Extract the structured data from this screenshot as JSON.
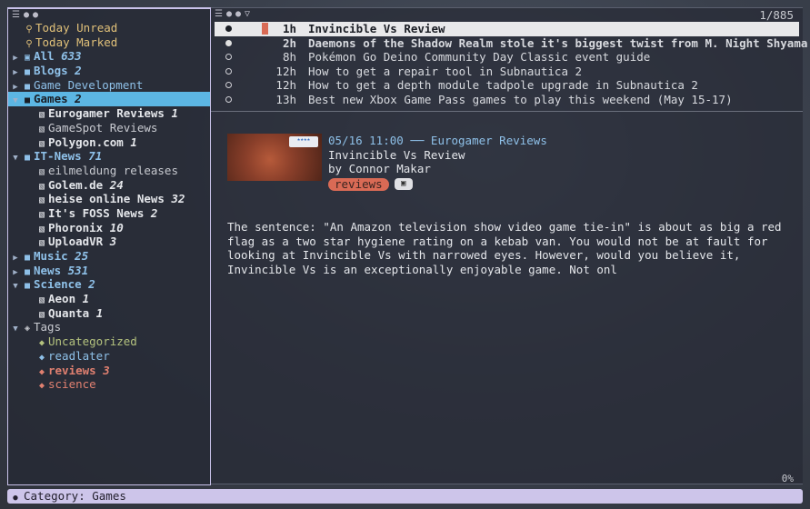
{
  "left_pane": {
    "tree": [
      {
        "level": 1,
        "arrow": "",
        "icon": "⚲",
        "label": "Today Unread",
        "count": "",
        "color": "c-yellow",
        "bold": false,
        "icon_name": "search-icon",
        "name": "today-unread"
      },
      {
        "level": 1,
        "arrow": "",
        "icon": "⚲",
        "label": "Today Marked",
        "count": "",
        "color": "c-yellow",
        "bold": false,
        "icon_name": "search-icon",
        "name": "today-marked"
      },
      {
        "level": 0,
        "arrow": "▶",
        "icon": "▣",
        "label": "All",
        "count": "633",
        "color": "c-blue",
        "bold": true,
        "icon_name": "all-feeds-icon",
        "name": "all"
      },
      {
        "level": 0,
        "arrow": "▶",
        "icon": "■",
        "label": "Blogs",
        "count": "2",
        "color": "c-blue",
        "bold": true,
        "icon_name": "folder-icon",
        "name": "blogs"
      },
      {
        "level": 0,
        "arrow": "▶",
        "icon": "■",
        "label": "Game Development",
        "count": "",
        "color": "c-blue",
        "bold": false,
        "icon_name": "folder-icon",
        "name": "game-development"
      },
      {
        "level": 0,
        "arrow": "▼",
        "icon": "■",
        "label": "Games",
        "count": "2",
        "color": "",
        "bold": true,
        "icon_name": "folder-icon",
        "name": "games",
        "selected": true
      },
      {
        "level": 2,
        "arrow": "",
        "icon": "▧",
        "label": "Eurogamer Reviews",
        "count": "1",
        "color": "c-white",
        "bold": true,
        "icon_name": "rss-icon",
        "name": "eurogamer-reviews"
      },
      {
        "level": 2,
        "arrow": "",
        "icon": "▧",
        "label": "GameSpot Reviews",
        "count": "",
        "color": "c-dim",
        "bold": false,
        "icon_name": "rss-icon",
        "name": "gamespot-reviews"
      },
      {
        "level": 2,
        "arrow": "",
        "icon": "▧",
        "label": "Polygon.com",
        "count": "1",
        "color": "c-white",
        "bold": true,
        "icon_name": "rss-icon",
        "name": "polygon"
      },
      {
        "level": 0,
        "arrow": "▼",
        "icon": "■",
        "label": "IT-News",
        "count": "71",
        "color": "c-blue",
        "bold": true,
        "icon_name": "folder-icon",
        "name": "it-news"
      },
      {
        "level": 2,
        "arrow": "",
        "icon": "▧",
        "label": "eilmeldung releases",
        "count": "",
        "color": "c-dim",
        "bold": false,
        "icon_name": "rss-icon",
        "name": "eilmeldung-releases"
      },
      {
        "level": 2,
        "arrow": "",
        "icon": "▧",
        "label": "Golem.de",
        "count": "24",
        "color": "c-white",
        "bold": true,
        "icon_name": "rss-icon",
        "name": "golem"
      },
      {
        "level": 2,
        "arrow": "",
        "icon": "▧",
        "label": "heise online News",
        "count": "32",
        "color": "c-white",
        "bold": true,
        "icon_name": "rss-icon",
        "name": "heise"
      },
      {
        "level": 2,
        "arrow": "",
        "icon": "▧",
        "label": "It's FOSS News",
        "count": "2",
        "color": "c-white",
        "bold": true,
        "icon_name": "rss-icon",
        "name": "its-foss"
      },
      {
        "level": 2,
        "arrow": "",
        "icon": "▧",
        "label": "Phoronix",
        "count": "10",
        "color": "c-white",
        "bold": true,
        "icon_name": "rss-icon",
        "name": "phoronix"
      },
      {
        "level": 2,
        "arrow": "",
        "icon": "▧",
        "label": "UploadVR",
        "count": "3",
        "color": "c-white",
        "bold": true,
        "icon_name": "rss-icon",
        "name": "uploadvr"
      },
      {
        "level": 0,
        "arrow": "▶",
        "icon": "■",
        "label": "Music",
        "count": "25",
        "color": "c-blue",
        "bold": true,
        "icon_name": "folder-icon",
        "name": "music"
      },
      {
        "level": 0,
        "arrow": "▶",
        "icon": "■",
        "label": "News",
        "count": "531",
        "color": "c-blue",
        "bold": true,
        "icon_name": "folder-icon",
        "name": "news"
      },
      {
        "level": 0,
        "arrow": "▼",
        "icon": "■",
        "label": "Science",
        "count": "2",
        "color": "c-blue",
        "bold": true,
        "icon_name": "folder-icon",
        "name": "science"
      },
      {
        "level": 2,
        "arrow": "",
        "icon": "▧",
        "label": "Aeon",
        "count": "1",
        "color": "c-white",
        "bold": true,
        "icon_name": "rss-icon",
        "name": "aeon"
      },
      {
        "level": 2,
        "arrow": "",
        "icon": "▧",
        "label": "Quanta",
        "count": "1",
        "color": "c-white",
        "bold": true,
        "icon_name": "rss-icon",
        "name": "quanta"
      },
      {
        "level": 0,
        "arrow": "▼",
        "icon": "◈",
        "label": "Tags",
        "count": "",
        "color": "c-dim",
        "bold": false,
        "icon_name": "tags-icon",
        "name": "tags"
      },
      {
        "level": 2,
        "arrow": "",
        "icon": "◆",
        "label": "Uncategorized",
        "count": "",
        "color": "c-green",
        "bold": false,
        "icon_name": "tag-icon",
        "name": "tag-uncategorized"
      },
      {
        "level": 2,
        "arrow": "",
        "icon": "◆",
        "label": "readlater",
        "count": "",
        "color": "c-blue",
        "bold": false,
        "icon_name": "tag-icon",
        "name": "tag-readlater"
      },
      {
        "level": 2,
        "arrow": "",
        "icon": "◆",
        "label": "reviews",
        "count": "3",
        "color": "c-red",
        "bold": true,
        "icon_name": "tag-icon",
        "name": "tag-reviews"
      },
      {
        "level": 2,
        "arrow": "",
        "icon": "◆",
        "label": "science",
        "count": "",
        "color": "c-red",
        "bold": false,
        "icon_name": "tag-icon",
        "name": "tag-science"
      }
    ]
  },
  "article_list": {
    "counter": "1/885",
    "rows": [
      {
        "status": "filled",
        "flag": true,
        "age": "1h",
        "title": "Invincible Vs Review",
        "bold": true,
        "selected": true
      },
      {
        "status": "filled",
        "flag": false,
        "age": "2h",
        "title": "Daemons of the Shadow Realm stole it's biggest twist from M. Night Shyama",
        "bold": true,
        "selected": false
      },
      {
        "status": "hollow",
        "flag": false,
        "age": "8h",
        "title": "Pokémon Go Deino Community Day Classic event guide",
        "bold": false,
        "selected": false
      },
      {
        "status": "hollow",
        "flag": false,
        "age": "12h",
        "title": "How to get a repair tool in Subnautica 2",
        "bold": false,
        "selected": false
      },
      {
        "status": "hollow",
        "flag": false,
        "age": "12h",
        "title": "How to get a depth module tadpole upgrade in Subnautica 2",
        "bold": false,
        "selected": false
      },
      {
        "status": "hollow",
        "flag": false,
        "age": "13h",
        "title": "Best new Xbox Game Pass games to play this weekend (May 15-17)",
        "bold": false,
        "selected": false
      }
    ]
  },
  "article": {
    "date": "05/16 11:00",
    "separator": "──",
    "feed": "Eurogamer Reviews",
    "title": "Invincible Vs Review",
    "author": "by Connor Makar",
    "tag": "reviews",
    "thumb_badge": "★★★★",
    "body": "The sentence: \"An Amazon television show video game tie-in\" is about as big a red\nflag as a two star hygiene rating on a kebab van. You would not be at fault for\nlooking at Invincible Vs with narrowed eyes. However, would you believe it,\nInvincible Vs is an exceptionally enjoyable game. Not onl",
    "scroll_percent": "0%"
  },
  "status_bar": {
    "text": "Category: Games"
  },
  "colors": {
    "selection_blue": "#5cb6e3",
    "status_bar": "#cdc5ea",
    "accent_red": "#d96a55"
  }
}
